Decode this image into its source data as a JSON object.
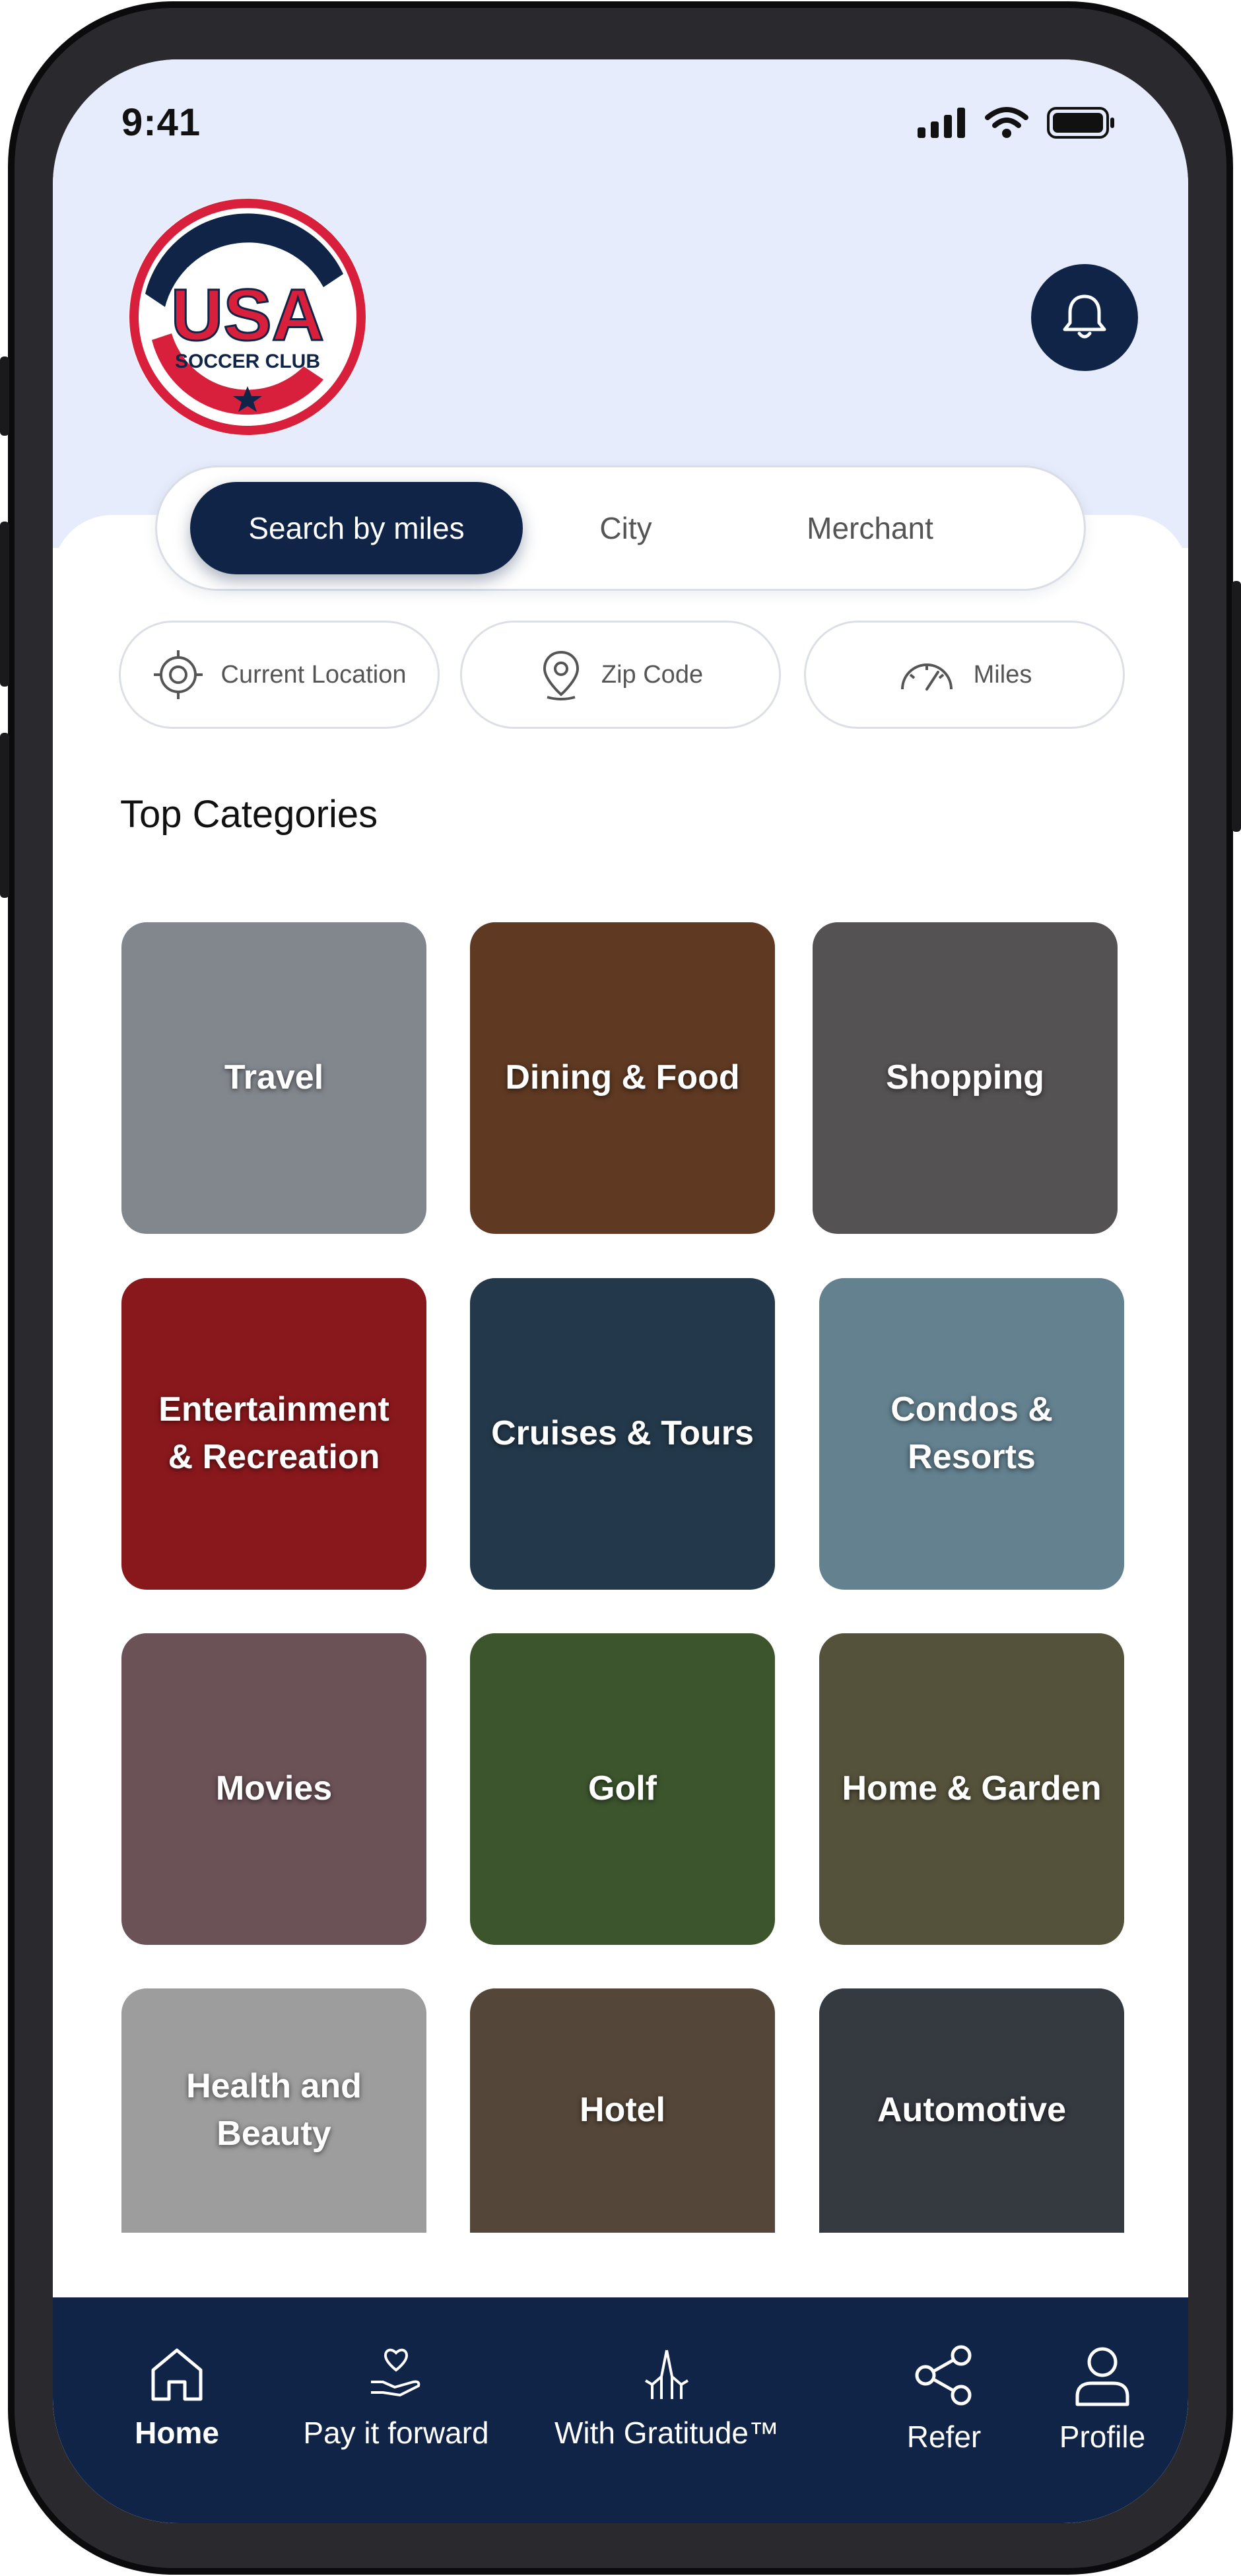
{
  "status_bar": {
    "time": "9:41"
  },
  "logo": {
    "line1": "USA",
    "line2": "SOCCER CLUB"
  },
  "search_modes": [
    {
      "label": "Search by miles",
      "active": true
    },
    {
      "label": "City",
      "active": false
    },
    {
      "label": "Merchant",
      "active": false
    }
  ],
  "filters": [
    {
      "label": "Current Location",
      "icon": "crosshair-icon"
    },
    {
      "label": "Zip Code",
      "icon": "map-pin-icon"
    },
    {
      "label": "Miles",
      "icon": "speedometer-icon"
    }
  ],
  "section_title": "Top Categories",
  "categories": [
    {
      "label": "Travel",
      "color": "#a7aeb6"
    },
    {
      "label": "Dining & Food",
      "color": "#7a4a2c"
    },
    {
      "label": "Shopping",
      "color": "#6d6a6c"
    },
    {
      "label": "Entertainment & Recreation",
      "color": "#b01f24"
    },
    {
      "label": "Cruises & Tours",
      "color": "#2d4960"
    },
    {
      "label": "Condos & Resorts",
      "color": "#7fa6b8"
    },
    {
      "label": "Movies",
      "color": "#8a6a70"
    },
    {
      "label": "Golf",
      "color": "#4e6e3a"
    },
    {
      "label": "Home & Garden",
      "color": "#6e6a4c"
    },
    {
      "label": "Health and Beauty",
      "color": "#c9c9c9"
    },
    {
      "label": "Hotel",
      "color": "#6c5a48"
    },
    {
      "label": "Automotive",
      "color": "#454a52"
    }
  ],
  "nav": [
    {
      "label": "Home",
      "icon": "home-icon",
      "active": true
    },
    {
      "label": "Pay it forward",
      "icon": "heart-hand-icon",
      "active": false
    },
    {
      "label": "With Gratitude™",
      "icon": "praying-hands-icon",
      "active": false
    },
    {
      "label": "Refer",
      "icon": "share-icon",
      "active": false
    },
    {
      "label": "Profile",
      "icon": "user-icon",
      "active": false
    }
  ],
  "colors": {
    "navy": "#0f2447",
    "header_bg": "#e6ecfb",
    "logo_red": "#d81f3c"
  }
}
